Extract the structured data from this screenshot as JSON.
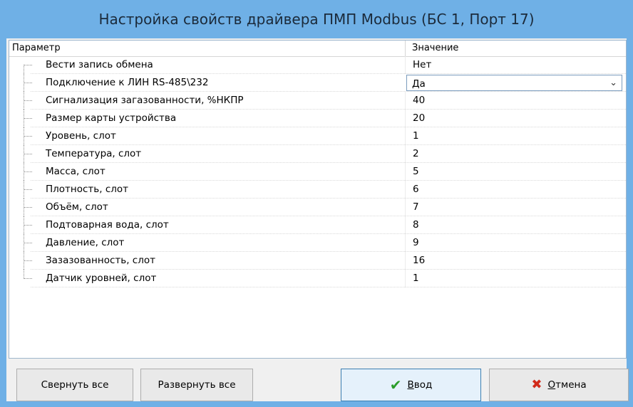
{
  "window": {
    "title": "Настройка свойств драйвера ПМП Modbus (БС 1, Порт 17)"
  },
  "grid": {
    "col_param": "Параметр",
    "col_value": "Значение",
    "rows": [
      {
        "name": "Вести запись обмена",
        "value": "Нет"
      },
      {
        "name": "Подключение к ЛИН RS-485\\232",
        "value": "Да",
        "editor": "dropdown"
      },
      {
        "name": "Сигнализация загазованности, %НКПР",
        "value": "40"
      },
      {
        "name": "Размер карты устройства",
        "value": "20"
      },
      {
        "name": "Уровень, слот",
        "value": "1"
      },
      {
        "name": "Температура, слот",
        "value": "2"
      },
      {
        "name": "Масса, слот",
        "value": "5"
      },
      {
        "name": "Плотность, слот",
        "value": "6"
      },
      {
        "name": "Объём, слот",
        "value": "7"
      },
      {
        "name": "Подтоварная вода, слот",
        "value": "8"
      },
      {
        "name": "Давление, слот",
        "value": "9"
      },
      {
        "name": "Зазазованность, слот",
        "value": "16"
      },
      {
        "name": "Датчик уровней, слот",
        "value": "1"
      }
    ]
  },
  "buttons": {
    "collapse_all": "Свернуть все",
    "expand_all": "Развернуть все",
    "ok_underlined": "В",
    "ok_rest": "вод",
    "cancel_underlined": "О",
    "cancel_rest": "тмена"
  },
  "icons": {
    "ok": "checkmark-icon",
    "cancel": "cross-icon",
    "dropdown": "chevron-down-icon"
  },
  "colors": {
    "title_bar": "#6fb0e6",
    "ok_icon": "#2a9d2a",
    "cancel_icon": "#d12a1a"
  }
}
